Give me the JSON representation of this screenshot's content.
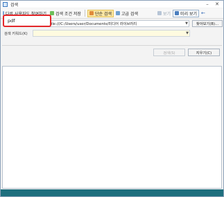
{
  "window": {
    "title": "검색"
  },
  "toolbar": {
    "items": [
      {
        "label": "다른 사용자도 참여하기"
      },
      {
        "label": "검색 조건 저장"
      },
      {
        "label": "단순 검색"
      },
      {
        "label": "고급 검색"
      },
      {
        "label": "보기"
      },
      {
        "label": "미리 보기"
      }
    ]
  },
  "search": {
    "keyword_value": "pdf",
    "location_path": "file:///C:/Users/user/Documents/미디어 라이브러리",
    "browse_label": "찾아보기(B)..."
  },
  "keyword_row": {
    "label": "검색 키워드(K)"
  },
  "buttons": {
    "stop": "검색(S)",
    "clear": "지우기(C)"
  },
  "colors": {
    "highlight": "#e3262a",
    "status": "#1e6f7e",
    "active_tab": "#fbe6a2"
  }
}
